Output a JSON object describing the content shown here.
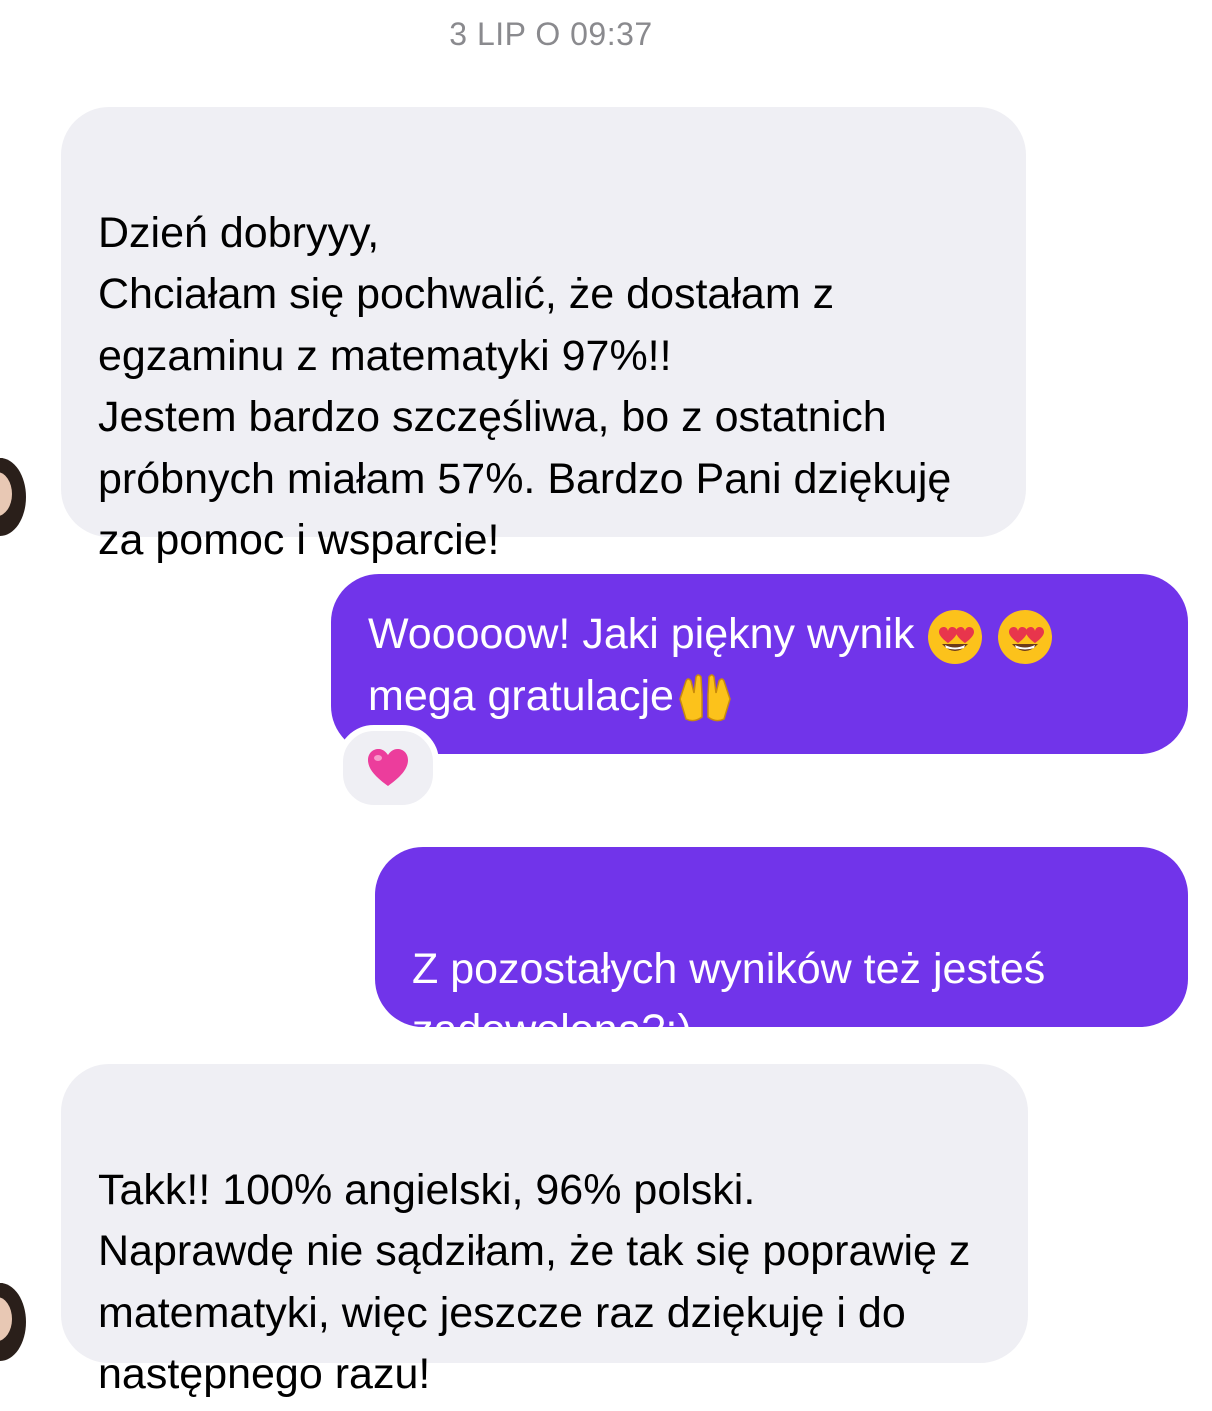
{
  "chat": {
    "timestamp": "3 LIP O 09:37",
    "messages": [
      {
        "direction": "incoming",
        "text": "Dzień dobryyy,\nChciałam się pochwalić, że dostałam z egzaminu z matematyki 97%!!\nJestem bardzo szczęśliwa, bo z ostatnich próbnych miałam 57%. Bardzo Pani dziękuję za pomoc i wsparcie!"
      },
      {
        "direction": "outgoing",
        "text_line1": "Wooooow! Jaki piękny wynik",
        "text_line2": "mega gratulacje",
        "emojis": [
          "heart-eyes-emoji",
          "heart-eyes-emoji",
          "raising-hands-emoji"
        ],
        "reaction": "pink-heart-emoji"
      },
      {
        "direction": "outgoing",
        "text": "Z pozostałych wyników też jesteś zadowolona?;)"
      },
      {
        "direction": "incoming",
        "text": "Takk!! 100% angielski, 96% polski.\nNaprawdę nie sądziłam, że tak się poprawię z matematyki, więc jeszcze raz dziękuję i do następnego razu!"
      }
    ]
  },
  "colors": {
    "incoming_bubble": "#efeff4",
    "outgoing_bubble": "#7134ea",
    "timestamp": "#8a8a8e"
  }
}
